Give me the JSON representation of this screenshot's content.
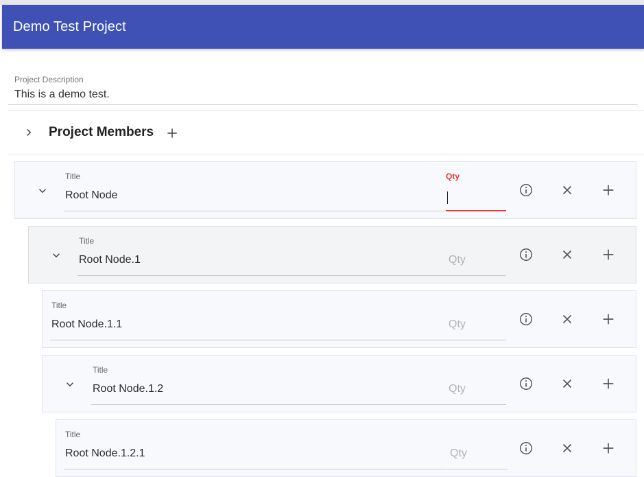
{
  "app": {
    "title": "Demo Test Project"
  },
  "project": {
    "description_label": "Project Description",
    "description_value": "This is a demo test."
  },
  "members": {
    "title": "Project Members"
  },
  "nodes": [
    {
      "title_label": "Title",
      "title_value": "Root Node",
      "qty_label": "Qty",
      "qty_placeholder": "",
      "has_toggle": true,
      "qty_focused": true
    },
    {
      "title_label": "Title",
      "title_value": "Root Node.1",
      "qty_label": "",
      "qty_placeholder": "Qty",
      "has_toggle": true,
      "qty_focused": false
    },
    {
      "title_label": "Title",
      "title_value": "Root Node.1.1",
      "qty_label": "",
      "qty_placeholder": "Qty",
      "has_toggle": false,
      "qty_focused": false
    },
    {
      "title_label": "Title",
      "title_value": "Root Node.1.2",
      "qty_label": "",
      "qty_placeholder": "Qty",
      "has_toggle": true,
      "qty_focused": false
    },
    {
      "title_label": "Title",
      "title_value": "Root Node.1.2.1",
      "qty_label": "",
      "qty_placeholder": "Qty",
      "has_toggle": false,
      "qty_focused": false
    }
  ],
  "icons": {
    "toggle": "chevron-down-icon",
    "info": "info-icon",
    "remove": "close-icon",
    "add": "plus-icon",
    "members_toggle": "chevron-right-icon",
    "members_add": "plus-icon"
  },
  "colors": {
    "appbar": "#3f51b5",
    "focus": "#e53935"
  }
}
